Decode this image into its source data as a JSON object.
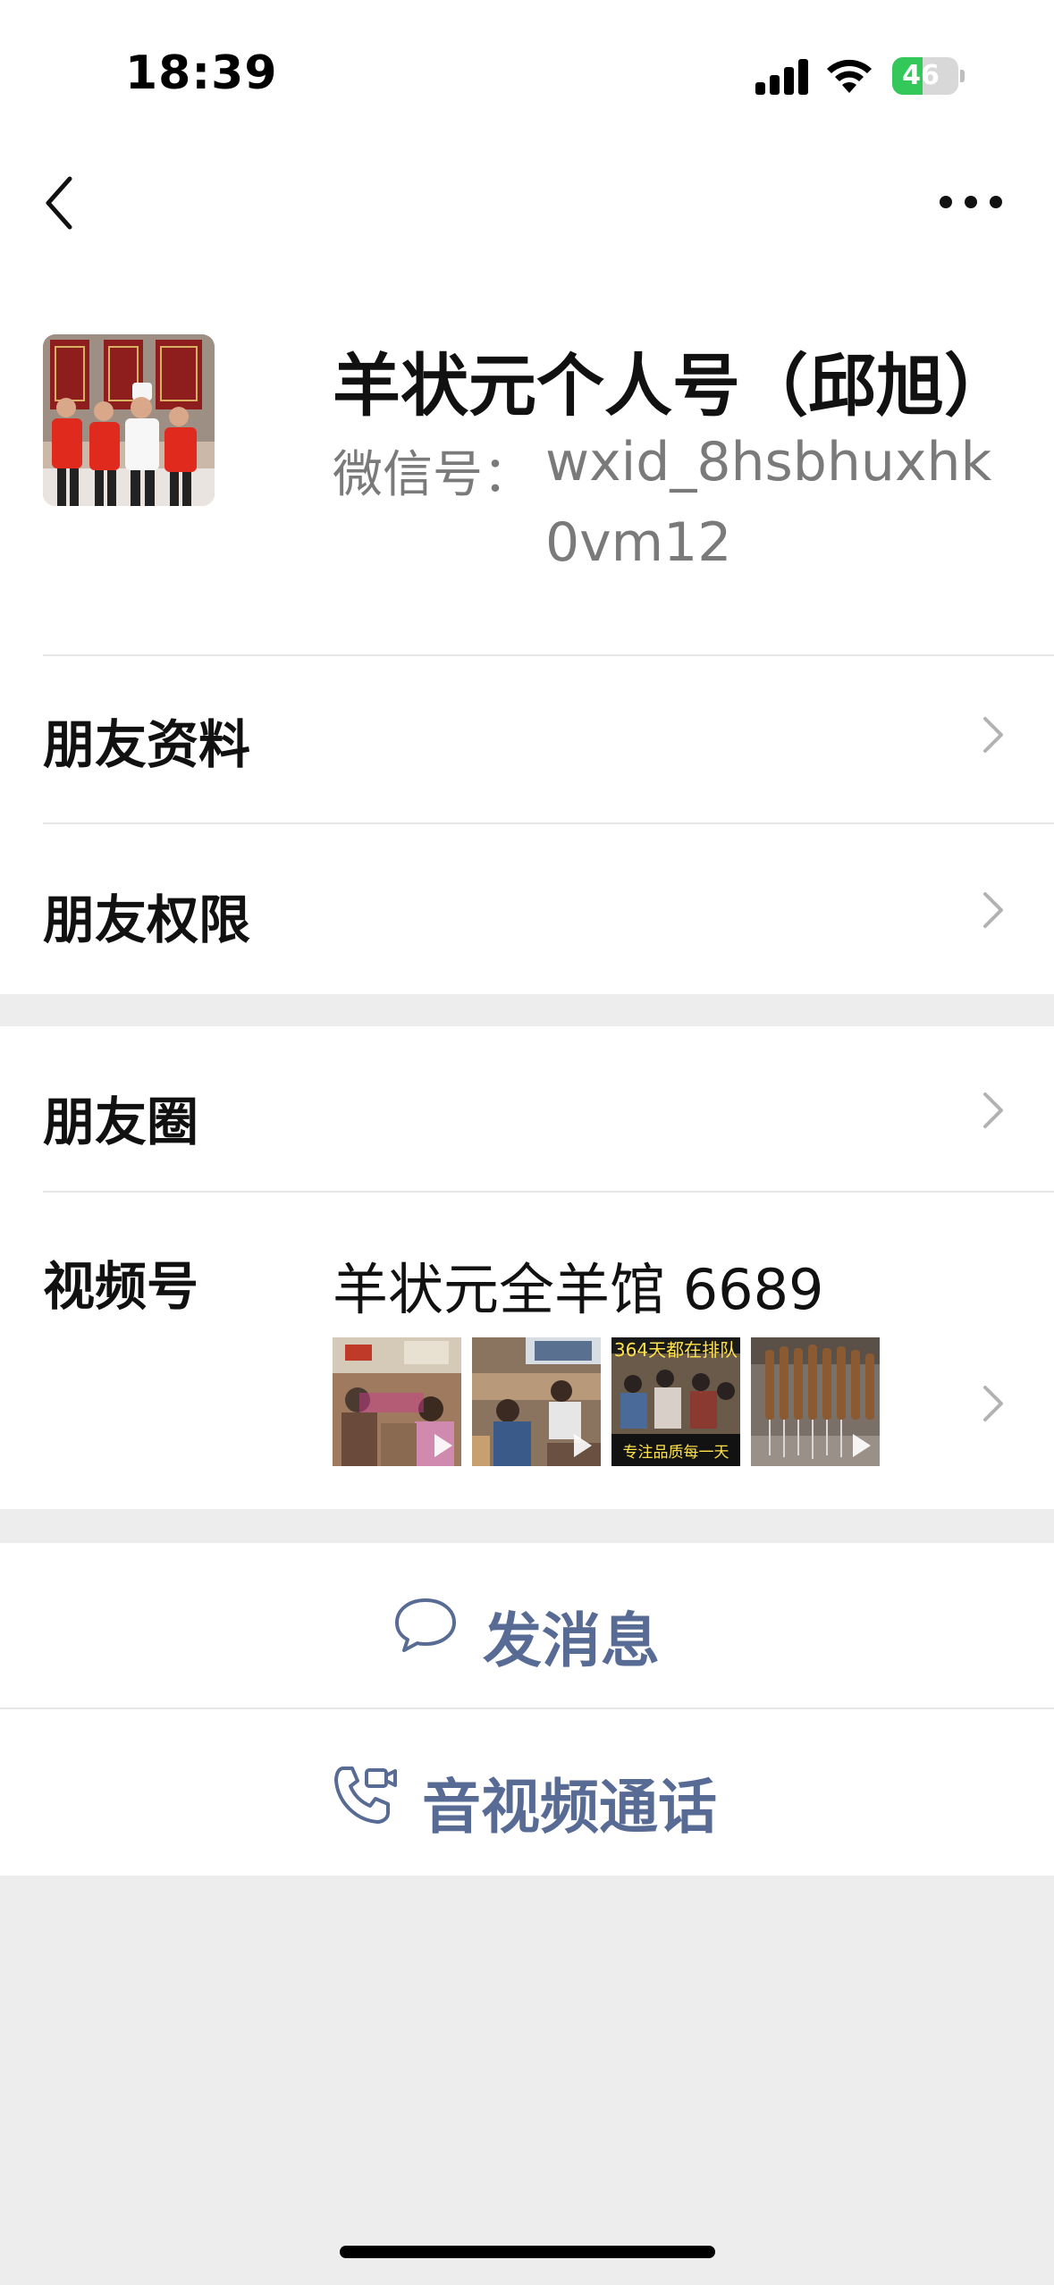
{
  "status_bar": {
    "time": "18:39",
    "battery": "46",
    "battery_level": 0.46
  },
  "nav": {
    "back_icon": "chevron-left-icon",
    "more_icon": "more-dots-icon"
  },
  "profile": {
    "name": "羊状元个人号（邱旭）",
    "wechat_id_label": "微信号：",
    "wechat_id": "wxid_8hsbhuxhk0vm12"
  },
  "rows": {
    "friend_info": "朋友资料",
    "friend_permissions": "朋友权限",
    "moments": "朋友圈",
    "channels": "视频号"
  },
  "channels": {
    "name": "羊状元全羊馆 6689",
    "thumbnails": [
      {
        "caption": ""
      },
      {
        "caption": ""
      },
      {
        "caption_top": "364天都在排队",
        "caption_bottom": "专注品质每一天"
      },
      {
        "caption": ""
      }
    ]
  },
  "actions": {
    "send_message": "发消息",
    "av_call": "音视频通话"
  },
  "colors": {
    "link_blue": "#576b95",
    "background": "#ededed",
    "battery_green": "#34c759"
  }
}
